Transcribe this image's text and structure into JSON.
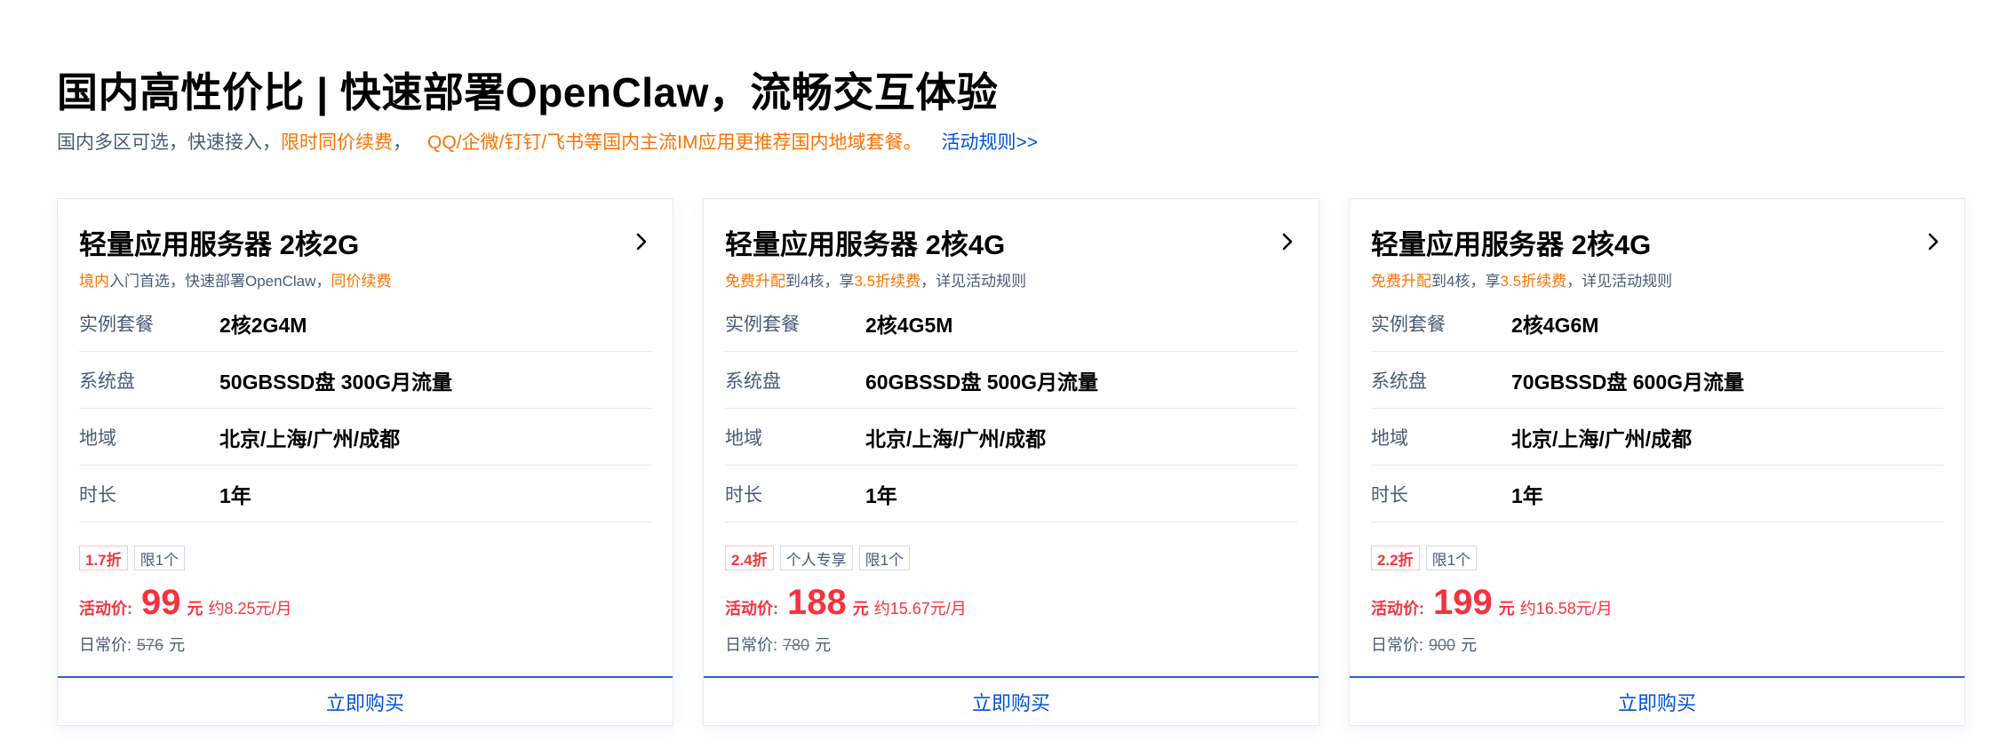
{
  "page": {
    "title": "国内高性价比 | 快速部署OpenClaw，流畅交互体验",
    "subtitle": {
      "part1": "国内多区可选，快速接入，",
      "highlight1": "限时同价续费",
      "part2": "，",
      "highlight2": "QQ/企微/钉钉/飞书等国内主流IM应用更推荐国内地域套餐。",
      "link": "活动规则>>"
    }
  },
  "colors": {
    "accent_orange": "#ff7200",
    "price_red": "#f5333f",
    "link_blue": "#0052d9",
    "text_gray": "#4b5b76"
  },
  "cards": [
    {
      "title": "轻量应用服务器 2核2G",
      "chevron_icon": "chevron-right-icon",
      "desc": {
        "h1": "境内",
        "t1": "入门首选，快速部署OpenClaw，",
        "h2": "同价续费",
        "t2": ""
      },
      "specs": [
        {
          "label": "实例套餐",
          "value": "2核2G4M"
        },
        {
          "label": "系统盘",
          "value": "50GBSSD盘 300G月流量"
        },
        {
          "label": "地域",
          "value": "北京/上海/广州/成都"
        },
        {
          "label": "时长",
          "value": "1年"
        }
      ],
      "discount_tag": "1.7折",
      "tags": [
        "限1个"
      ],
      "price_label": "活动价:",
      "price": "99",
      "price_unit": "元",
      "monthly": "约8.25元/月",
      "orig_label": "日常价:",
      "orig_price": "576",
      "orig_unit": "元",
      "buy_label": "立即购买"
    },
    {
      "title": "轻量应用服务器 2核4G",
      "chevron_icon": "chevron-right-icon",
      "desc": {
        "h1": "免费升配",
        "t1": "到4核，享",
        "h2": "3.5折续费",
        "t2": "，详见活动规则"
      },
      "specs": [
        {
          "label": "实例套餐",
          "value": "2核4G5M"
        },
        {
          "label": "系统盘",
          "value": "60GBSSD盘 500G月流量"
        },
        {
          "label": "地域",
          "value": "北京/上海/广州/成都"
        },
        {
          "label": "时长",
          "value": "1年"
        }
      ],
      "discount_tag": "2.4折",
      "tags": [
        "个人专享",
        "限1个"
      ],
      "price_label": "活动价:",
      "price": "188",
      "price_unit": "元",
      "monthly": "约15.67元/月",
      "orig_label": "日常价:",
      "orig_price": "780",
      "orig_unit": "元",
      "buy_label": "立即购买"
    },
    {
      "title": "轻量应用服务器 2核4G",
      "chevron_icon": "chevron-right-icon",
      "desc": {
        "h1": "免费升配",
        "t1": "到4核，享",
        "h2": "3.5折续费",
        "t2": "，详见活动规则"
      },
      "specs": [
        {
          "label": "实例套餐",
          "value": "2核4G6M"
        },
        {
          "label": "系统盘",
          "value": "70GBSSD盘 600G月流量"
        },
        {
          "label": "地域",
          "value": "北京/上海/广州/成都"
        },
        {
          "label": "时长",
          "value": "1年"
        }
      ],
      "discount_tag": "2.2折",
      "tags": [
        "限1个"
      ],
      "price_label": "活动价:",
      "price": "199",
      "price_unit": "元",
      "monthly": "约16.58元/月",
      "orig_label": "日常价:",
      "orig_price": "900",
      "orig_unit": "元",
      "buy_label": "立即购买"
    }
  ]
}
